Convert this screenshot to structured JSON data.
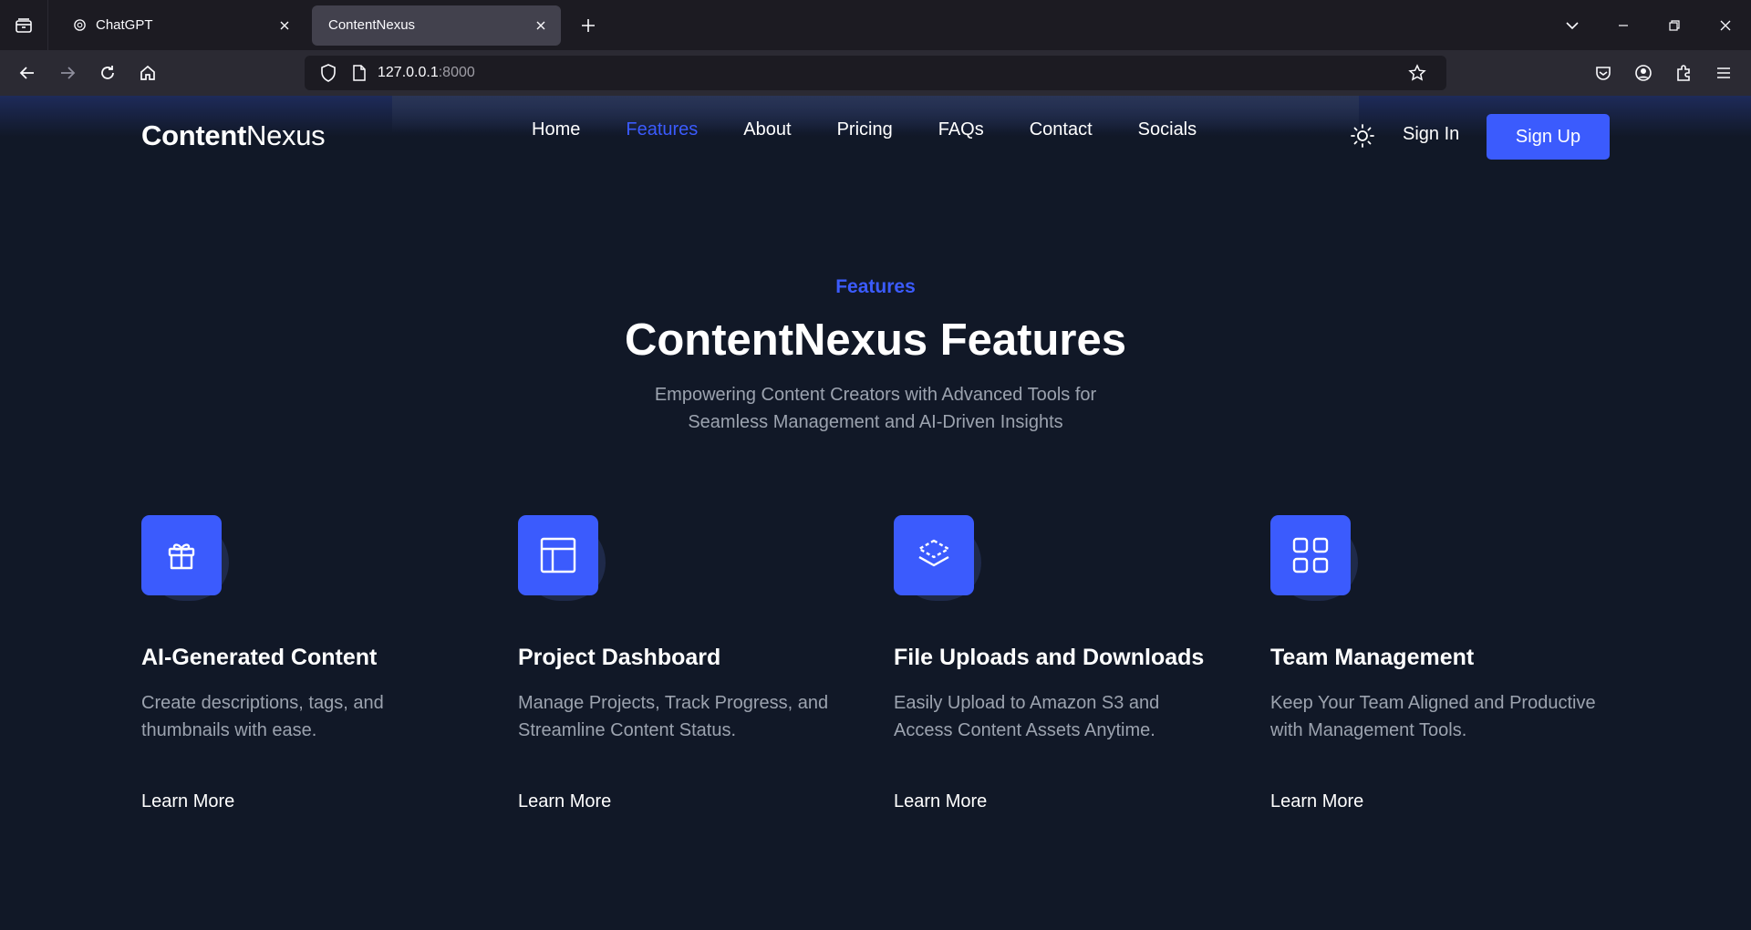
{
  "browser": {
    "tabs": [
      {
        "title": "ChatGPT",
        "active": false
      },
      {
        "title": "ContentNexus",
        "active": true
      }
    ],
    "url_host": "127.0.0.1",
    "url_port": ":8000"
  },
  "site": {
    "logo_bold": "Content",
    "logo_light": "Nexus",
    "nav": [
      "Home",
      "Features",
      "About",
      "Pricing",
      "FAQs",
      "Contact",
      "Socials"
    ],
    "active_nav": "Features",
    "sign_in": "Sign In",
    "sign_up": "Sign Up",
    "accent_color": "#3b5bfd",
    "background_color": "#111827"
  },
  "hero": {
    "eyebrow": "Features",
    "title": "ContentNexus Features",
    "subtitle": "Empowering Content Creators with Advanced Tools for Seamless Management and AI-Driven Insights"
  },
  "features": [
    {
      "icon": "gift-icon",
      "title": "AI-Generated Content",
      "description": "Create descriptions, tags, and thumbnails with ease.",
      "link": "Learn More"
    },
    {
      "icon": "layout-icon",
      "title": "Project Dashboard",
      "description": "Manage Projects, Track Progress, and Streamline Content Status.",
      "link": "Learn More"
    },
    {
      "icon": "layers-icon",
      "title": "File Uploads and Downloads",
      "description": "Easily Upload to Amazon S3 and Access Content Assets Anytime.",
      "link": "Learn More"
    },
    {
      "icon": "grid-icon",
      "title": "Team Management",
      "description": "Keep Your Team Aligned and Productive with Management Tools.",
      "link": "Learn More"
    }
  ]
}
